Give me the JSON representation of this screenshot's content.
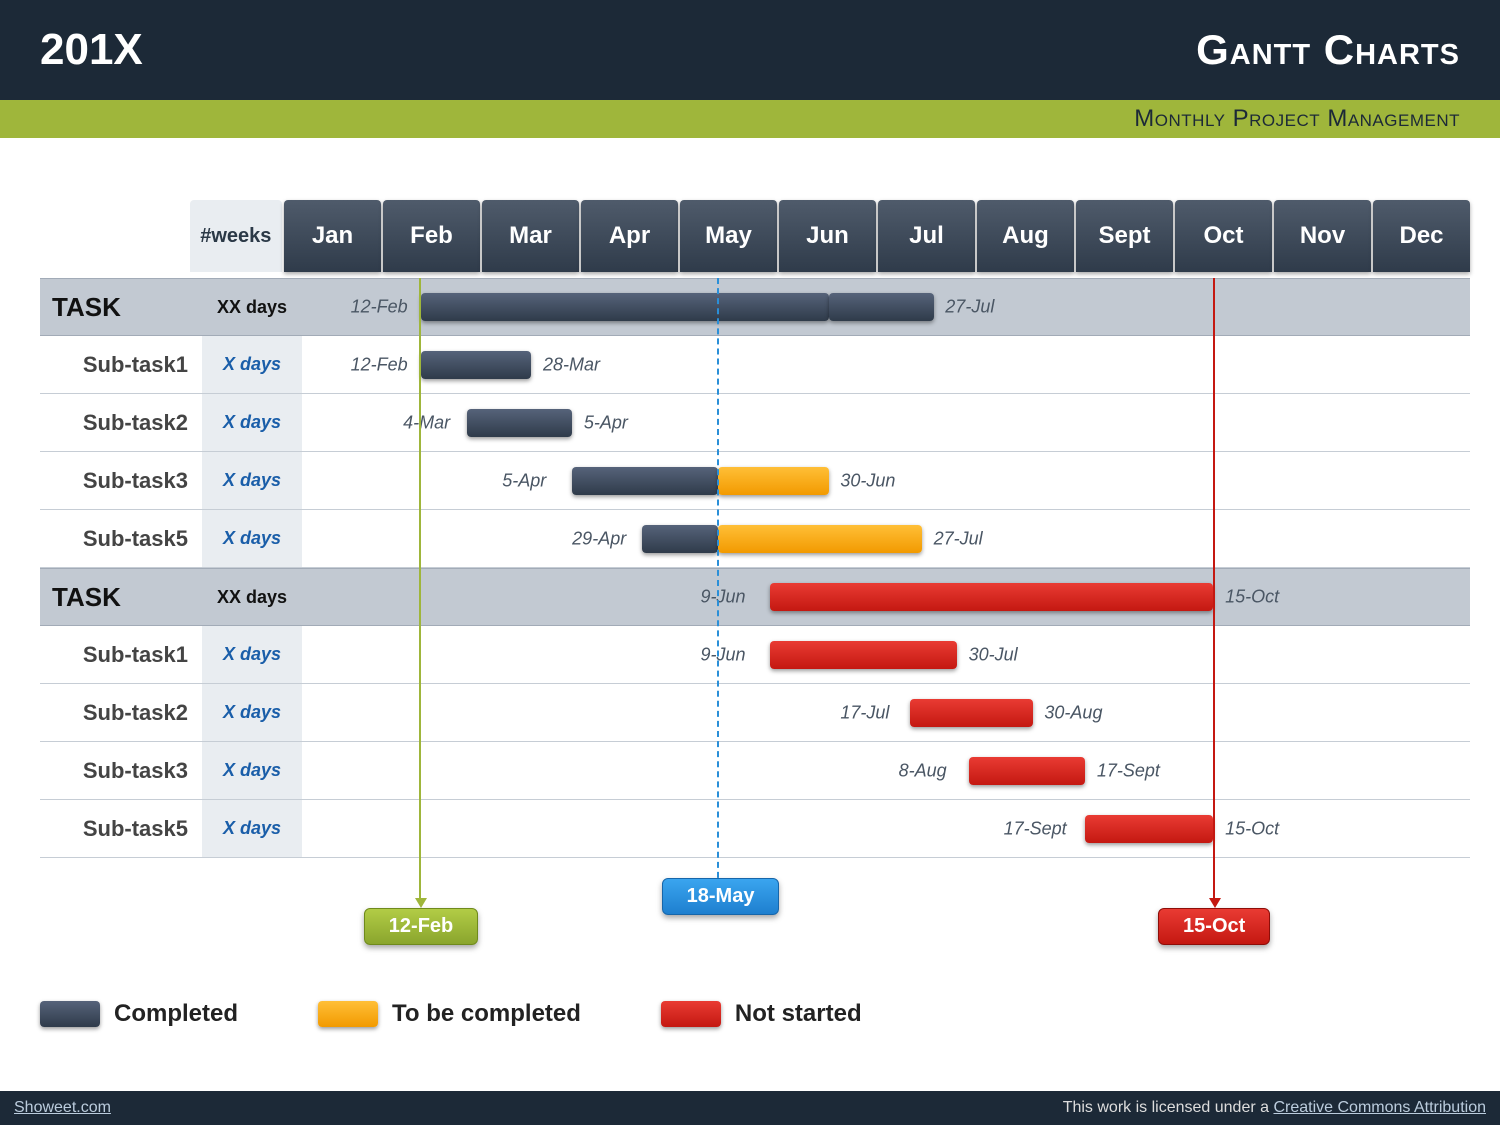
{
  "header": {
    "year": "201X",
    "title": "Gantt Charts",
    "subtitle": "Monthly Project Management"
  },
  "columns": {
    "weeks": "#weeks"
  },
  "months": [
    "Jan",
    "Feb",
    "Mar",
    "Apr",
    "May",
    "Jun",
    "Jul",
    "Aug",
    "Sept",
    "Oct",
    "Nov",
    "Dec"
  ],
  "rows": [
    {
      "name": "TASK",
      "days": "XX days",
      "main": true,
      "bars": [
        {
          "status": "dark",
          "start_pct": 10,
          "end_pct": 45
        },
        {
          "status": "dark",
          "start_pct": 45,
          "end_pct": 54
        }
      ],
      "labels": [
        {
          "text": "12-Feb",
          "at_pct": 4,
          "align": "right"
        },
        {
          "text": "27-Jul",
          "at_pct": 55,
          "align": "left"
        }
      ]
    },
    {
      "name": "Sub-task1",
      "days": "X days",
      "bars": [
        {
          "status": "dark",
          "start_pct": 10,
          "end_pct": 19.5
        }
      ],
      "labels": [
        {
          "text": "12-Feb",
          "at_pct": 4,
          "align": "right"
        },
        {
          "text": "28-Mar",
          "at_pct": 20.5,
          "align": "left"
        }
      ]
    },
    {
      "name": "Sub-task2",
      "days": "X days",
      "bars": [
        {
          "status": "dark",
          "start_pct": 14,
          "end_pct": 23
        }
      ],
      "labels": [
        {
          "text": "4-Mar",
          "at_pct": 8.5,
          "align": "right"
        },
        {
          "text": "5-Apr",
          "at_pct": 24,
          "align": "left"
        }
      ]
    },
    {
      "name": "Sub-task3",
      "days": "X days",
      "bars": [
        {
          "status": "dark",
          "start_pct": 23,
          "end_pct": 35.5
        },
        {
          "status": "amber",
          "start_pct": 35.5,
          "end_pct": 45
        }
      ],
      "labels": [
        {
          "text": "5-Apr",
          "at_pct": 17,
          "align": "right"
        },
        {
          "text": "30-Jun",
          "at_pct": 46,
          "align": "left"
        }
      ]
    },
    {
      "name": "Sub-task5",
      "days": "X days",
      "bars": [
        {
          "status": "dark",
          "start_pct": 29,
          "end_pct": 35.5
        },
        {
          "status": "amber",
          "start_pct": 35.5,
          "end_pct": 53
        }
      ],
      "labels": [
        {
          "text": "29-Apr",
          "at_pct": 23,
          "align": "right"
        },
        {
          "text": "27-Jul",
          "at_pct": 54,
          "align": "left"
        }
      ]
    },
    {
      "name": "TASK",
      "days": "XX days",
      "main": true,
      "bars": [
        {
          "status": "red",
          "start_pct": 40,
          "end_pct": 78
        }
      ],
      "labels": [
        {
          "text": "9-Jun",
          "at_pct": 34,
          "align": "right"
        },
        {
          "text": "15-Oct",
          "at_pct": 79,
          "align": "left"
        }
      ]
    },
    {
      "name": "Sub-task1",
      "days": "X days",
      "bars": [
        {
          "status": "red",
          "start_pct": 40,
          "end_pct": 56
        }
      ],
      "labels": [
        {
          "text": "9-Jun",
          "at_pct": 34,
          "align": "right"
        },
        {
          "text": "30-Jul",
          "at_pct": 57,
          "align": "left"
        }
      ]
    },
    {
      "name": "Sub-task2",
      "days": "X days",
      "bars": [
        {
          "status": "red",
          "start_pct": 52,
          "end_pct": 62.5
        }
      ],
      "labels": [
        {
          "text": "17-Jul",
          "at_pct": 46,
          "align": "right"
        },
        {
          "text": "30-Aug",
          "at_pct": 63.5,
          "align": "left"
        }
      ]
    },
    {
      "name": "Sub-task3",
      "days": "X days",
      "bars": [
        {
          "status": "red",
          "start_pct": 57,
          "end_pct": 67
        }
      ],
      "labels": [
        {
          "text": "8-Aug",
          "at_pct": 51,
          "align": "right"
        },
        {
          "text": "17-Sept",
          "at_pct": 68,
          "align": "left"
        }
      ]
    },
    {
      "name": "Sub-task5",
      "days": "X days",
      "bars": [
        {
          "status": "red",
          "start_pct": 67,
          "end_pct": 78
        }
      ],
      "labels": [
        {
          "text": "17-Sept",
          "at_pct": 60,
          "align": "right"
        },
        {
          "text": "15-Oct",
          "at_pct": 79,
          "align": "left"
        }
      ]
    }
  ],
  "markers": {
    "start": {
      "text": "12-Feb",
      "pct": 10,
      "color": "green"
    },
    "today": {
      "text": "18-May",
      "pct": 35.5,
      "color": "blue"
    },
    "end": {
      "text": "15-Oct",
      "pct": 78,
      "color": "red"
    }
  },
  "legend": [
    {
      "status": "dark",
      "text": "Completed"
    },
    {
      "status": "amber",
      "text": "To be completed"
    },
    {
      "status": "red",
      "text": "Not started"
    }
  ],
  "footer": {
    "left": "Showeet.com",
    "right_prefix": "This work is licensed under a ",
    "right_link": "Creative Commons Attribution"
  },
  "chart_data": {
    "type": "gantt",
    "time_axis": {
      "unit": "month",
      "categories": [
        "Jan",
        "Feb",
        "Mar",
        "Apr",
        "May",
        "Jun",
        "Jul",
        "Aug",
        "Sept",
        "Oct",
        "Nov",
        "Dec"
      ]
    },
    "statuses": {
      "dark": "Completed",
      "amber": "To be completed",
      "red": "Not started"
    },
    "milestones": {
      "start": "12-Feb",
      "today": "18-May",
      "end": "15-Oct"
    },
    "tasks": [
      {
        "name": "TASK",
        "duration": "XX days",
        "segments": [
          {
            "status": "Completed",
            "start": "12-Feb",
            "end": "27-Jul"
          }
        ]
      },
      {
        "name": "Sub-task1",
        "duration": "X days",
        "parent": "TASK",
        "segments": [
          {
            "status": "Completed",
            "start": "12-Feb",
            "end": "28-Mar"
          }
        ]
      },
      {
        "name": "Sub-task2",
        "duration": "X days",
        "parent": "TASK",
        "segments": [
          {
            "status": "Completed",
            "start": "4-Mar",
            "end": "5-Apr"
          }
        ]
      },
      {
        "name": "Sub-task3",
        "duration": "X days",
        "parent": "TASK",
        "segments": [
          {
            "status": "Completed",
            "start": "5-Apr",
            "end": "18-May"
          },
          {
            "status": "To be completed",
            "start": "18-May",
            "end": "30-Jun"
          }
        ]
      },
      {
        "name": "Sub-task5",
        "duration": "X days",
        "parent": "TASK",
        "segments": [
          {
            "status": "Completed",
            "start": "29-Apr",
            "end": "18-May"
          },
          {
            "status": "To be completed",
            "start": "18-May",
            "end": "27-Jul"
          }
        ]
      },
      {
        "name": "TASK",
        "duration": "XX days",
        "segments": [
          {
            "status": "Not started",
            "start": "9-Jun",
            "end": "15-Oct"
          }
        ]
      },
      {
        "name": "Sub-task1",
        "duration": "X days",
        "parent": "TASK",
        "segments": [
          {
            "status": "Not started",
            "start": "9-Jun",
            "end": "30-Jul"
          }
        ]
      },
      {
        "name": "Sub-task2",
        "duration": "X days",
        "parent": "TASK",
        "segments": [
          {
            "status": "Not started",
            "start": "17-Jul",
            "end": "30-Aug"
          }
        ]
      },
      {
        "name": "Sub-task3",
        "duration": "X days",
        "parent": "TASK",
        "segments": [
          {
            "status": "Not started",
            "start": "8-Aug",
            "end": "17-Sept"
          }
        ]
      },
      {
        "name": "Sub-task5",
        "duration": "X days",
        "parent": "TASK",
        "segments": [
          {
            "status": "Not started",
            "start": "17-Sept",
            "end": "15-Oct"
          }
        ]
      }
    ]
  }
}
